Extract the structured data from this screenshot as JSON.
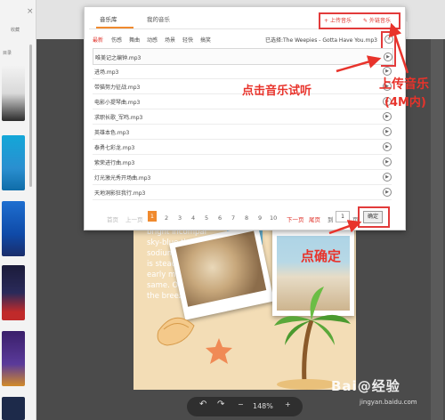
{
  "sidebar": {
    "close_glyph": "×",
    "label_top": "收藏",
    "label_mid": "目录"
  },
  "header": {
    "right_tab": "文字"
  },
  "modal": {
    "tabs": [
      "音乐库",
      "我的音乐"
    ],
    "upload_label": "上传音乐",
    "external_label": "外链音乐",
    "categories": [
      "最新",
      "伤感",
      "舞曲",
      "动感",
      "场景",
      "轻快",
      "搞笑"
    ],
    "selected_text": "已选择:The Weepies - Gotta Have You.mp3",
    "songs": [
      "唯美记之编钟.mp3",
      "进场.mp3",
      "带猫努力征战.mp3",
      "电影小提琴曲.mp3",
      "求职长歌_军鸣.mp3",
      "英雄本色.mp3",
      "泰勇七彩龙.mp3",
      "紫荣进行曲.mp3",
      "灯光激光秀开场曲.mp3",
      "天地洞影狂我行.mp3"
    ],
    "pager": {
      "first": "首页",
      "prev": "上一页",
      "pages": [
        "1",
        "2",
        "3",
        "4",
        "5",
        "6",
        "7",
        "8",
        "9",
        "10"
      ],
      "next": "下一页",
      "last": "尾页",
      "goto_prefix": "到",
      "goto_value": "1",
      "goto_suffix": "页",
      "ok": "确定"
    }
  },
  "canvas": {
    "poem_lines": [
      "bright incompar",
      "sky-blue th",
      "sodium",
      "is steady",
      "early morne",
      "same. Occ",
      "the breeze"
    ]
  },
  "zoom": {
    "undo": "↶",
    "redo": "↷",
    "minus": "−",
    "value": "148%",
    "plus": "+"
  },
  "annotations": {
    "click_preview": "点击音乐试听",
    "upload_music": "上传音乐",
    "upload_limit": "(4M内)",
    "click_ok": "点确定"
  },
  "watermark": {
    "brand": "Bai@经验",
    "url": "jingyan.baidu.com"
  },
  "colors": {
    "accent": "#f08a2e",
    "annotation": "#e8332b"
  }
}
